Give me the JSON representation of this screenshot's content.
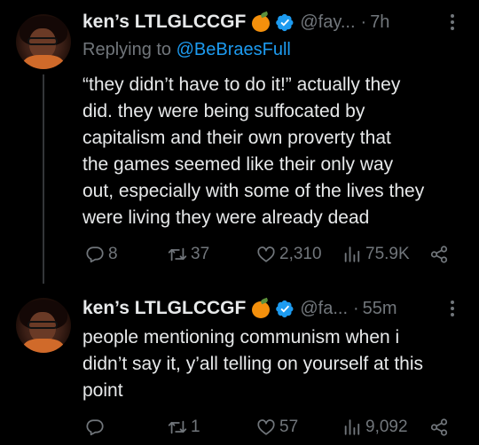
{
  "tweets": [
    {
      "display_name": "ken’s LTLGLCCGF",
      "handle": "@fay...",
      "separator": "·",
      "time": "7h",
      "replying_prefix": "Replying to",
      "replying_to": "@BeBraesFull",
      "text_lines": [
        "“they didn’t have to do it!” actually they",
        "did. they were being suffocated by",
        "capitalism and their own proverty that",
        "the games seemed like their only way",
        "out, especially with some of the lives they",
        "were living they were already dead"
      ],
      "replies": "8",
      "retweets": "37",
      "likes": "2,310",
      "views": "75.9K"
    },
    {
      "display_name": "ken’s LTLGLCCGF",
      "handle": "@fa...",
      "separator": "·",
      "time": "55m",
      "text_lines": [
        "people mentioning communism when i",
        "didn’t say it, y’all telling on yourself at this",
        "point"
      ],
      "replies": "",
      "retweets": "1",
      "likes": "57",
      "views": "9,092"
    }
  ],
  "icons": {
    "emoji": "tangerine-emoji",
    "verified": "verified-badge-icon",
    "more": "more-icon",
    "reply": "reply-icon",
    "retweet": "retweet-icon",
    "like": "heart-icon",
    "views": "views-icon",
    "share": "share-icon"
  },
  "colors": {
    "background": "#000000",
    "text": "#e7e9ea",
    "secondary": "#71767b",
    "accent": "#1d9bf0",
    "thread_line": "#333639"
  }
}
